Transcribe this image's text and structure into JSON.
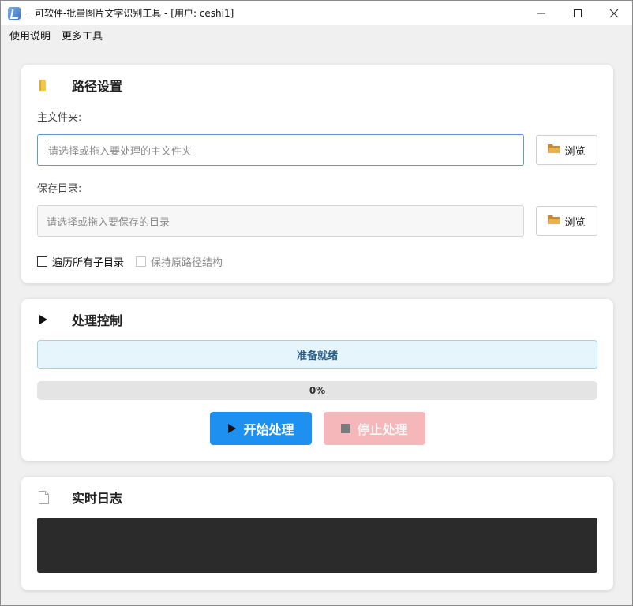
{
  "window": {
    "title": "一可软件-批量图片文字识别工具 - [用户: ceshi1]"
  },
  "menu": {
    "items": [
      "使用说明",
      "更多工具"
    ]
  },
  "path_section": {
    "title": "路径设置",
    "icon": "folder-icon",
    "main_folder_label": "主文件夹:",
    "main_folder_placeholder": "请选择或拖入要处理的主文件夹",
    "main_folder_value": "",
    "save_dir_label": "保存目录:",
    "save_dir_placeholder": "请选择或拖入要保存的目录",
    "save_dir_value": "",
    "browse_label": "浏览",
    "recurse_label": "遍历所有子目录",
    "recurse_checked": false,
    "keep_structure_label": "保持原路径结构",
    "keep_structure_checked": false,
    "keep_structure_enabled": false
  },
  "control_section": {
    "title": "处理控制",
    "icon": "play-icon",
    "status": "准备就绪",
    "progress_percent": 0,
    "progress_text": "0%",
    "start_label": "开始处理",
    "stop_label": "停止处理",
    "colors": {
      "status_bg": "#e6f4fc",
      "start": "#1e90f0",
      "stop_disabled": "#f5b7ba"
    }
  },
  "log_section": {
    "title": "实时日志",
    "icon": "document-icon",
    "log_text": ""
  }
}
